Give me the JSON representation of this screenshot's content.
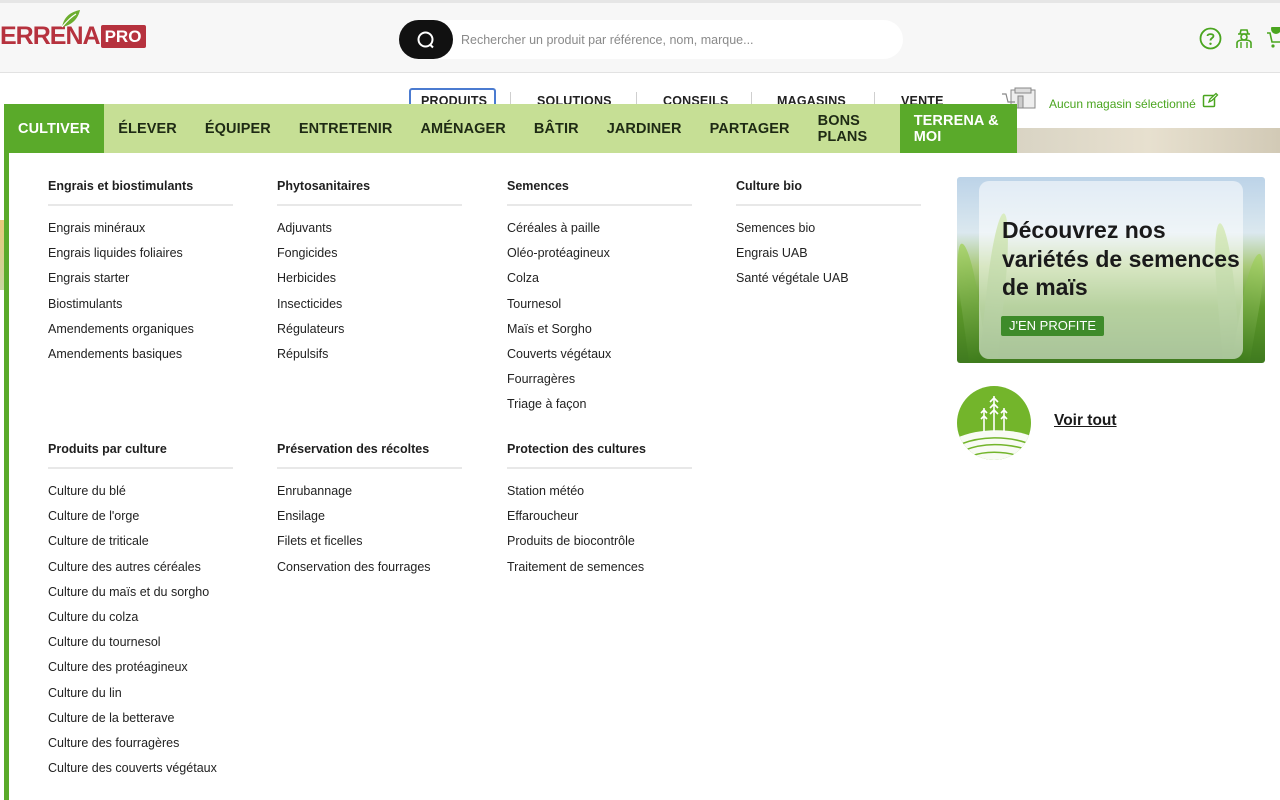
{
  "brand": {
    "logo_text": "ERRENA",
    "logo_pro": "PRO",
    "primary_color": "#b6323e",
    "green": "#5aaa2a",
    "light_green": "#c6df95"
  },
  "search": {
    "placeholder": "Rechercher un produit par référence, nom, marque..."
  },
  "header_icons": [
    "help-icon",
    "farmer-account-icon",
    "cart-icon"
  ],
  "subnav": {
    "items": [
      "PRODUITS",
      "SOLUTIONS",
      "CONSEILS",
      "MAGASINS",
      "VENTE"
    ],
    "active": "PRODUITS",
    "store_label": "Aucun magasin sélectionné"
  },
  "categories": [
    {
      "label": "CULTIVER",
      "active": true
    },
    {
      "label": "ÉLEVER"
    },
    {
      "label": "ÉQUIPER"
    },
    {
      "label": "ENTRETENIR"
    },
    {
      "label": "AMÉNAGER"
    },
    {
      "label": "BÂTIR"
    },
    {
      "label": "JARDINER"
    },
    {
      "label": "PARTAGER"
    },
    {
      "label": "BONS PLANS"
    },
    {
      "label": "TERRENA & MOI",
      "highlight": true
    }
  ],
  "menu": {
    "columns": [
      {
        "title": "Engrais et biostimulants",
        "items": [
          "Engrais minéraux",
          "Engrais liquides foliaires",
          "Engrais starter",
          "Biostimulants",
          "Amendements organiques",
          "Amendements basiques"
        ]
      },
      {
        "title": "Phytosanitaires",
        "items": [
          "Adjuvants",
          "Fongicides",
          "Herbicides",
          "Insecticides",
          "Régulateurs",
          "Répulsifs"
        ]
      },
      {
        "title": "Semences",
        "items": [
          "Céréales à paille",
          "Oléo-protéagineux",
          "Colza",
          "Tournesol",
          "Maïs et Sorgho",
          "Couverts végétaux",
          "Fourragères",
          "Triage à façon"
        ]
      },
      {
        "title": "Culture bio",
        "items": [
          "Semences bio",
          "Engrais UAB",
          "Santé végétale UAB"
        ]
      },
      {
        "title": "Produits par culture",
        "items": [
          "Culture du blé",
          "Culture de l'orge",
          "Culture de triticale",
          "Culture des autres céréales",
          "Culture du maïs et du sorgho",
          "Culture du colza",
          "Culture du tournesol",
          "Culture des protéagineux",
          "Culture du lin",
          "Culture de la betterave",
          "Culture des fourragères",
          "Culture des couverts végétaux"
        ]
      },
      {
        "title": "Préservation des récoltes",
        "items": [
          "Enrubannage",
          "Ensilage",
          "Filets et ficelles",
          "Conservation des fourrages"
        ]
      },
      {
        "title": "Protection des cultures",
        "items": [
          "Station météo",
          "Effaroucheur",
          "Produits de biocontrôle",
          "Traitement de semences"
        ]
      }
    ]
  },
  "promo": {
    "title": "Découvrez nos variétés de semences de maïs",
    "button": "J'EN PROFITE"
  },
  "voir_tout": "Voir tout"
}
